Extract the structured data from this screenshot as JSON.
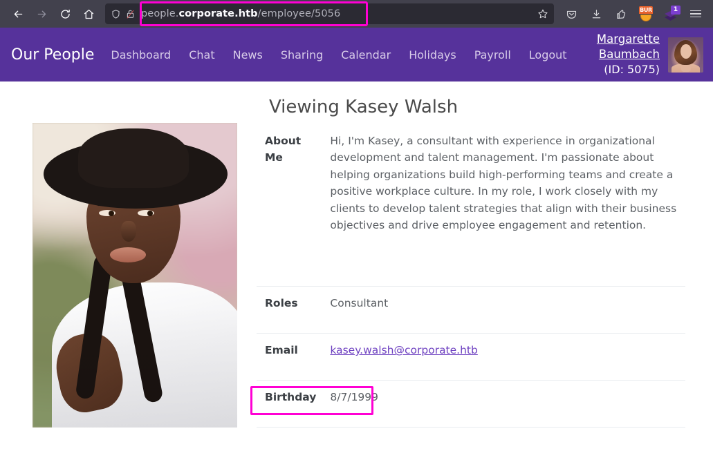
{
  "browser": {
    "back_label": "Back",
    "forward_label": "Forward",
    "reload_label": "Reload",
    "home_label": "Home",
    "url_prefix": "people.",
    "url_host": "corporate.htb",
    "url_path": "/employee/5056",
    "url_full": "people.corporate.htb/employee/5056",
    "bookmark_label": "Bookmark this page",
    "icons": {
      "shield": "shield-icon",
      "broken_lock": "broken-lock-icon",
      "star": "star-icon",
      "pocket": "pocket-icon",
      "downloads": "download-icon",
      "extension": "extension-icon",
      "burp": "burp-icon",
      "layers": "layers-icon",
      "menu": "hamburger-menu-icon"
    },
    "burp_label": "BUR",
    "layers_badge": "1",
    "highlight_color": "#ff00d4"
  },
  "header": {
    "brand": "Our People",
    "nav": [
      {
        "label": "Dashboard"
      },
      {
        "label": "Chat"
      },
      {
        "label": "News"
      },
      {
        "label": "Sharing"
      },
      {
        "label": "Calendar"
      },
      {
        "label": "Holidays"
      },
      {
        "label": "Payroll"
      },
      {
        "label": "Logout"
      }
    ],
    "user": {
      "name": "Margarette Baumbach",
      "id_text": "(ID: 5075)",
      "avatar_alt": "avatar"
    },
    "bg_color": "#56329b"
  },
  "main": {
    "title": "Viewing Kasey Walsh",
    "photo_alt": "Employee profile photo of Kasey Walsh",
    "rows": [
      {
        "key": "About Me",
        "value": "Hi, I'm Kasey, a consultant with experience in organizational development and talent management. I'm passionate about helping organizations build high-performing teams and create a positive workplace culture. In my role, I work closely with my clients to develop talent strategies that align with their business objectives and drive employee engagement and retention.",
        "type": "text"
      },
      {
        "key": "Roles",
        "value": "Consultant",
        "type": "text"
      },
      {
        "key": "Email",
        "value": "kasey.walsh@corporate.htb",
        "type": "link"
      },
      {
        "key": "Birthday",
        "value": "8/7/1999",
        "type": "text"
      }
    ],
    "link_color": "#6f42c1"
  }
}
